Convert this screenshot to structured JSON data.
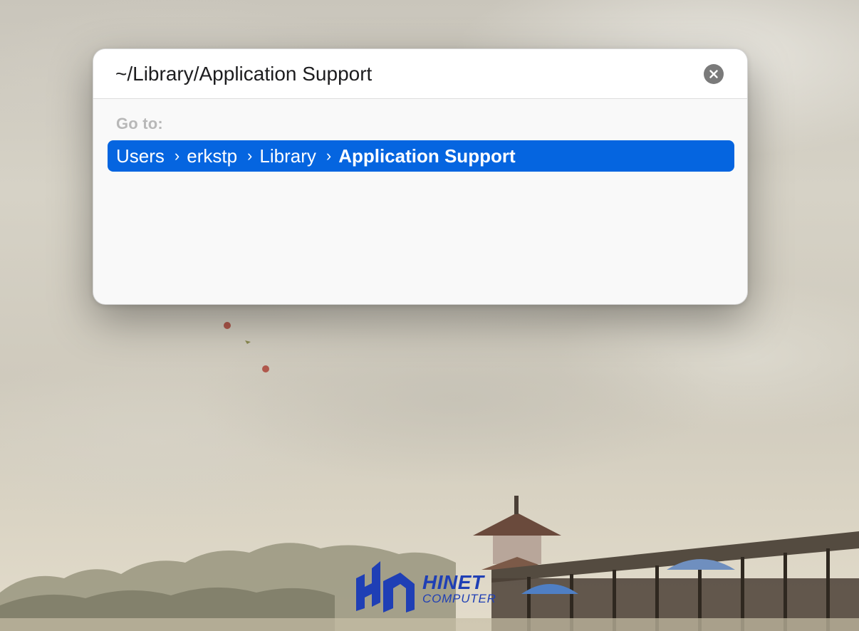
{
  "dialog": {
    "path_value": "~/Library/Application Support",
    "goto_label": "Go to:",
    "suggestion": {
      "crumbs": [
        "Users",
        "erkstp",
        "Library",
        "Application Support"
      ],
      "separator": "›"
    },
    "clear_icon": "xmark-circle-icon"
  },
  "watermark": {
    "brand": "HINET",
    "sub": "COMPUTER"
  },
  "colors": {
    "selection": "#0565e0",
    "label": "#b8b8b8",
    "logo": "#1f3fb5"
  }
}
